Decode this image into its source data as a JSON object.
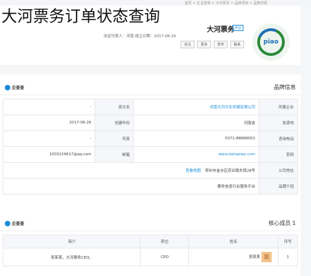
{
  "overlay_title": "大河票务订单状态查询",
  "breadcrumb": "首页 > 企业查询 > 大河票务 > 品牌项目 > 品牌详情",
  "header": {
    "company_name": "大河票务",
    "tag": "开业",
    "meta": "法定代表人：河南 成立日期：2017-06-26",
    "buttons": [
      "关注",
      "更多",
      "发布",
      "联系"
    ],
    "logo_text": "piao"
  },
  "brand_section": {
    "title": "品牌信息",
    "brand_label": "企查查",
    "rows": [
      {
        "label": "所属企业",
        "value": "河南大河文化传媒有限公司",
        "label2": "英文名",
        "value2": "-"
      },
      {
        "label": "发源地",
        "value": "河南省",
        "label2": "创建年份",
        "value2": "2017-06-26"
      },
      {
        "label": "咨询电话",
        "value": "0371-88888001",
        "label2": "传真",
        "value2": "-"
      },
      {
        "label": "官网",
        "value": "www.dahepiao.com",
        "label2": "邮箱",
        "value2": "1003229617@qq.com"
      },
      {
        "label": "公司地址",
        "value": "郑州市金水区农业路东段28号",
        "label2": "",
        "value2": ""
      },
      {
        "label": "品牌介绍",
        "value": "票务信息行业服务平台",
        "label2": "",
        "value2": ""
      }
    ],
    "map_link": "查看地图"
  },
  "members_section": {
    "title": "核心成员",
    "count": "1",
    "brand_label": "企查查",
    "columns": [
      "序号",
      "姓名",
      "职位",
      "简介"
    ],
    "rows": [
      {
        "index": "1",
        "avatar": "吴",
        "name": "吴某某",
        "position": "CEO",
        "intro": "吴某某，大河票务CEO。"
      }
    ]
  }
}
